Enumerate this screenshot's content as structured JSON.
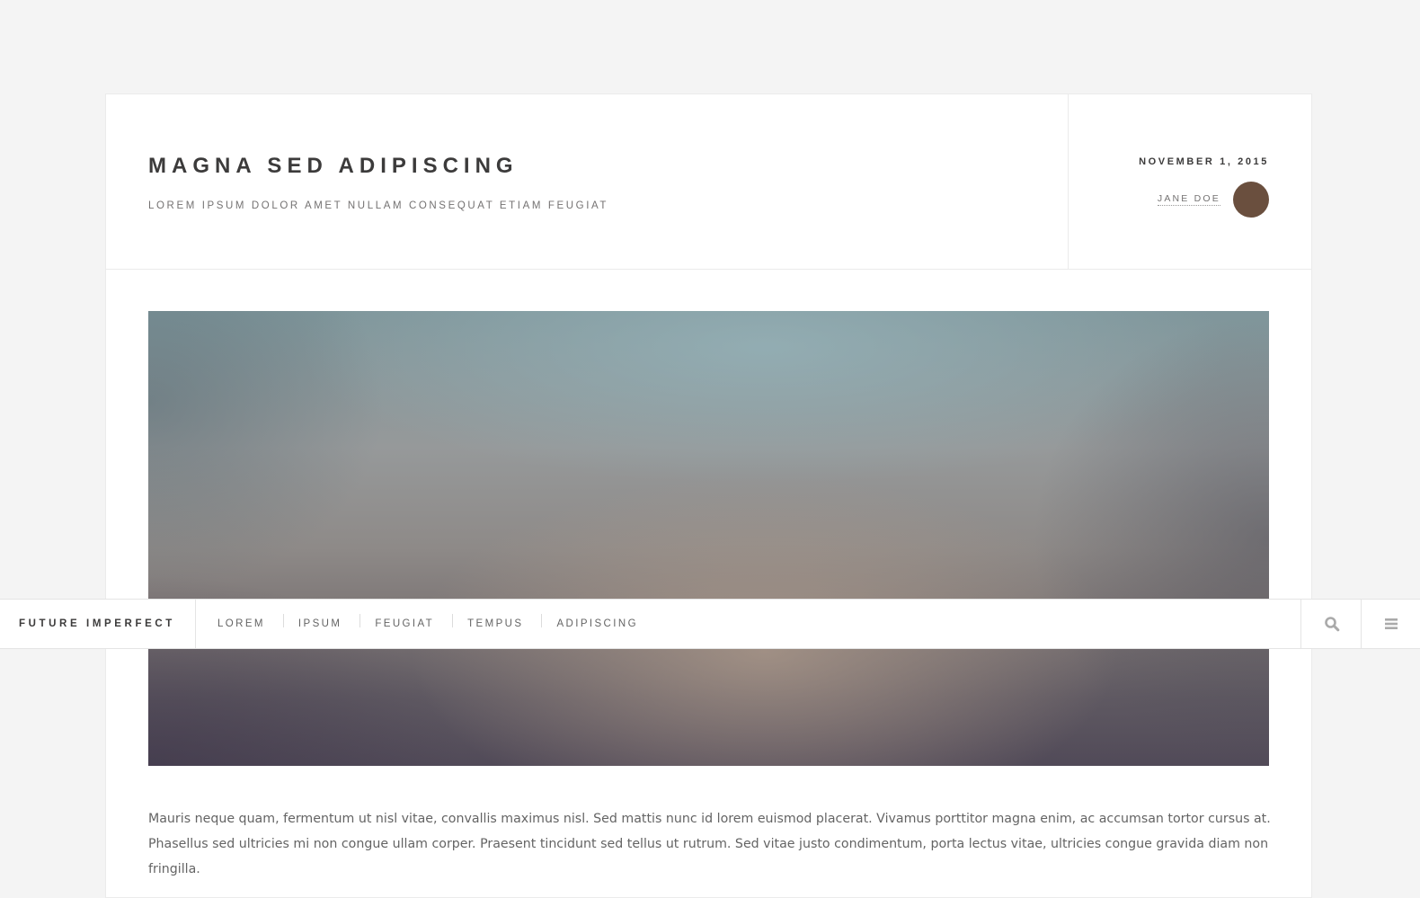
{
  "post": {
    "title": "MAGNA SED ADIPISCING",
    "subtitle": "LOREM IPSUM DOLOR AMET NULLAM CONSEQUAT ETIAM FEUGIAT",
    "date": "NOVEMBER 1, 2015",
    "author": "JANE DOE",
    "body": "Mauris neque quam, fermentum ut nisl vitae, convallis maximus nisl. Sed mattis nunc id lorem euismod placerat. Vivamus porttitor magna enim, ac accumsan tortor cursus at. Phasellus sed ultricies mi non congue ullam corper. Praesent tincidunt sed tellus ut rutrum. Sed vitae justo condimentum, porta lectus vitae, ultricies congue gravida diam non fringilla."
  },
  "navbar": {
    "logo": "FUTURE IMPERFECT",
    "links": [
      "LOREM",
      "IPSUM",
      "FEUGIAT",
      "TEMPUS",
      "ADIPISCING"
    ],
    "icons": {
      "search": "search-icon",
      "menu": "menu-icon"
    }
  },
  "colors": {
    "page_background": "#f4f4f4",
    "card_background": "#ffffff",
    "text_dark": "#3c3b3b",
    "text_muted": "#747272",
    "avatar": "#6a4f3e",
    "icon": "#aaaaaa"
  }
}
